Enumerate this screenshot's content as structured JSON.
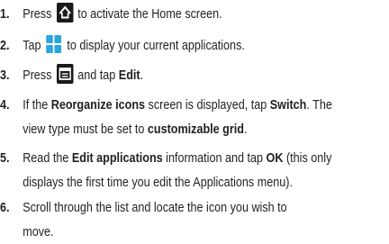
{
  "steps": [
    {
      "number": "1.",
      "line1": {
        "before": "Press",
        "icon": "home-icon",
        "after": "to activate the Home screen."
      }
    },
    {
      "number": "2.",
      "line1": {
        "before": "Tap",
        "icon": "applications-grid-icon",
        "after": "to display your current applications."
      }
    },
    {
      "number": "3.",
      "line1": {
        "before": "Press",
        "icon": "menu-key-icon",
        "mid": "and tap",
        "bold": "Edit",
        "end": "."
      }
    },
    {
      "number": "4.",
      "line1": {
        "before": "If the",
        "bold1": "Reorganize icons",
        "mid": "screen is displayed, tap",
        "bold2": "Switch",
        "end": ". The"
      },
      "line2": {
        "before": "view type must be set to",
        "bold": "customizable grid",
        "end": "."
      }
    },
    {
      "number": "5.",
      "line1": {
        "before": "Read the",
        "bold1": "Edit applications",
        "mid": "information and tap",
        "bold2": "OK",
        "end": "(this only"
      },
      "line2": {
        "text": "displays the first time you edit the Applications menu)."
      }
    },
    {
      "number": "6.",
      "line1": {
        "text": "Scroll through the list and locate the icon you wish to"
      },
      "line2": {
        "text": "move."
      }
    }
  ],
  "colors": {
    "icon_background": "#1a1a1a",
    "apps_icon_blue": "#2aa6e0",
    "text": "#231f20"
  }
}
